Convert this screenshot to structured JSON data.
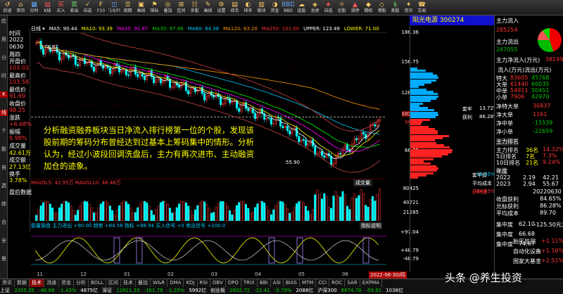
{
  "toolbar": [
    {
      "glyph": "↺",
      "label": "后退",
      "cls": "w"
    },
    {
      "glyph": "⌂",
      "label": "首页",
      "cls": ""
    },
    {
      "glyph": "▦",
      "label": "分时",
      "cls": "b"
    },
    {
      "glyph": "▤",
      "label": "K线",
      "cls": "r"
    },
    {
      "glyph": "买",
      "label": "买入",
      "cls": "r"
    },
    {
      "glyph": "卖",
      "label": "卖出",
      "cls": "gr"
    },
    {
      "glyph": "✓",
      "label": "自选",
      "cls": ""
    },
    {
      "glyph": "F",
      "label": "F10",
      "cls": ""
    },
    {
      "glyph": "◫",
      "label": "F10/F9",
      "cls": "b"
    },
    {
      "glyph": "☰",
      "label": "周期",
      "cls": ""
    },
    {
      "glyph": "▣",
      "label": "画线",
      "cls": ""
    },
    {
      "glyph": "⚑",
      "label": "指标",
      "cls": ""
    },
    {
      "glyph": "◎",
      "label": "叠加",
      "cls": ""
    },
    {
      "glyph": "⊞",
      "label": "区间",
      "cls": ""
    },
    {
      "glyph": "☷",
      "label": "多股",
      "cls": ""
    },
    {
      "glyph": "✎",
      "label": "画线",
      "cls": ""
    },
    {
      "glyph": "⚙",
      "label": "设置",
      "cls": ""
    },
    {
      "glyph": "▤",
      "label": "综合",
      "cls": ""
    },
    {
      "glyph": "◐",
      "label": "排名",
      "cls": ""
    },
    {
      "glyph": "▥",
      "label": "板块",
      "cls": ""
    },
    {
      "glyph": "◑",
      "label": "资金",
      "cls": ""
    },
    {
      "glyph": "BBD",
      "label": "BBD",
      "cls": "b"
    },
    {
      "glyph": "☁",
      "label": "选股",
      "cls": ""
    },
    {
      "glyph": "◈",
      "label": "龙虎",
      "cls": ""
    },
    {
      "glyph": "★",
      "label": "自选",
      "cls": "r"
    },
    {
      "glyph": "☼",
      "label": "论股",
      "cls": ""
    },
    {
      "glyph": "▲",
      "label": "涨停",
      "cls": "r"
    },
    {
      "glyph": "◆",
      "label": "期权",
      "cls": ""
    },
    {
      "glyph": "◇",
      "label": "港股",
      "cls": ""
    },
    {
      "glyph": "$",
      "label": "美股",
      "cls": "gr"
    },
    {
      "glyph": "✦",
      "label": "资讯",
      "cls": ""
    },
    {
      "glyph": "☎",
      "label": "交易",
      "cls": ""
    }
  ],
  "leftbar": [
    "应",
    "用",
    "分",
    "时",
    "K",
    "线",
    "个",
    "股",
    "自",
    "选",
    "综",
    "合",
    "全",
    "景"
  ],
  "info": {
    "time_label": "时间",
    "year": "2022",
    "date": "0630",
    "week_label": "周四",
    "open_label": "开盘价",
    "open": "103.03",
    "high_label": "最高价",
    "high": "103.58",
    "low_label": "最低价",
    "low": "91.69",
    "close_label": "收盘价",
    "close": "98.25",
    "change_label": "涨跌",
    "change": "+6.68%",
    "amp_label": "振幅",
    "amp": "9.98%",
    "vol_label": "成交量",
    "vol": "42.61万",
    "amt_label": "成交额",
    "amt": "27.13亿",
    "turn_label": "换手",
    "turn": "3.78%",
    "list_label": "盘后数据"
  },
  "ma_bar": [
    {
      "t": "日线 ▾",
      "c": "w"
    },
    {
      "t": "MA5: 90.44",
      "c": "w"
    },
    {
      "t": "MA10: 93.39",
      "c": "y"
    },
    {
      "t": "MA20: 91.87",
      "c": "m"
    },
    {
      "t": "MA30: 87.88",
      "c": "g"
    },
    {
      "t": "MA60: 84.38",
      "c": "c"
    },
    {
      "t": "MA120: 83.20",
      "c": "o"
    },
    {
      "t": "MA250: 101.00",
      "c": "r"
    },
    {
      "t": "UPPER: 123.49",
      "c": "w"
    },
    {
      "t": "LOWER: 71.00",
      "c": "y"
    }
  ],
  "price_axis": [
    "186.36",
    "156.75",
    "126.72",
    "103.03",
    "96.69",
    "66.65"
  ],
  "vol_axis": [
    "80425",
    "40721",
    "21285"
  ],
  "macd_axis": [
    "+97.04",
    "+48.79",
    "-48.79"
  ],
  "chart_labels": {
    "peak": "178.87",
    "low": "55.90",
    "vol_header": "MAVOL5: 42.95万  MAVOL10: 46.46万",
    "vol_tag": "成交量",
    "macd_header": "能量操盘  主力进出 +90.00  趋势 +84.58  指标 +88.94  买入信号 +0  卖出信号 +100.0",
    "macd_tag": "指标说明"
  },
  "x_axis": [
    "11",
    "12",
    "01",
    "02",
    "03",
    "04",
    "05",
    "06"
  ],
  "date_tag": "2022-06-30/四",
  "chart_data": {
    "type": "line",
    "title": "",
    "ylim": [
      55.9,
      186.36
    ],
    "x": [
      "2021-11",
      "2021-12",
      "2022-01",
      "2022-02",
      "2022-03",
      "2022-04",
      "2022-05",
      "2022-06"
    ],
    "series": [
      {
        "name": "",
        "values": [
          178.87,
          160,
          150,
          135,
          118,
          95,
          55.9,
          98.25
        ]
      }
    ]
  },
  "annotation": "分析融资融券板块当日净流入排行榜第一位的个股，发现该股前期的筹码分布曾经达到过基本上筹码集中的情形。分析认为，经过小波段回调洗盘后，主力有再次进市、主动融资加仓的迹象。",
  "stock_header": "阳光电源 300274",
  "side_panel": {
    "chip_label": "套牢",
    "chip_val": "13.72%",
    "profit_label": "获利",
    "profit_val": "86.28%",
    "cost_label": "平均成本",
    "cost_val": "89.70",
    "price_label": "收盘获利",
    "price_val": "84.65%",
    "label1": "套牢盘",
    "val1": "15.35%",
    "label2": "平均成本",
    "label3": "获利盘",
    "val3": "84.65%"
  },
  "right_panel": {
    "title": "主力流入",
    "flow_label": "主力流入",
    "flow_in": "285254",
    "flow_out_label": "主力流出",
    "flow_out": "247055",
    "net_label": "主力净流入(万元)",
    "net": "38199",
    "sub_title": "流入(万元)流出(万元)",
    "rows": [
      {
        "n": "特大",
        "a": "83605",
        "b": "45768"
      },
      {
        "n": "大单",
        "a": "61440",
        "b": "60035"
      },
      {
        "n": "中单",
        "a": "54911",
        "b": "50451"
      },
      {
        "n": "小单",
        "a": "7906",
        "b": "42970"
      }
    ],
    "net_rows": [
      {
        "n": "净特大单",
        "v": "36837",
        "c": "r"
      },
      {
        "n": "净大单",
        "v": "1161",
        "c": "r"
      },
      {
        "n": "净中单",
        "v": "-15539",
        "c": "g"
      },
      {
        "n": "净小单",
        "v": "-22659",
        "c": "g"
      }
    ],
    "rank_hdr": "主力排名",
    "rank_rows": [
      {
        "n": "主力排名",
        "v": "36名",
        "p": "14.32%"
      },
      {
        "n": "5日排名",
        "v": "7名",
        "p": "7.3%"
      },
      {
        "n": "10日排名",
        "v": "21名",
        "p": "9.24%"
      }
    ],
    "hist_hdr": "年度",
    "hist": [
      {
        "y": "2022",
        "a": "2.19",
        "b": "42.21"
      },
      {
        "y": "2023",
        "a": "2.94",
        "b": "55.67"
      }
    ],
    "stats": [
      {
        "n": "收盘获利",
        "v": "84.65%"
      },
      {
        "n": "光标获利",
        "v": "86.28%"
      },
      {
        "n": "平均成本",
        "v": "89.70"
      }
    ],
    "date": "20220630",
    "conc_label": "集中度",
    "conc": "62.10",
    "conc_range": "-125.50元之间",
    "conc2": "集中度",
    "conc2v": "66.68",
    "conc3": "集中度",
    "conc3v": "74.67",
    "hot_hdr": "所有板块排名",
    "hot": [
      {
        "n": "所有板块",
        "v": "涨幅"
      },
      {
        "n": "胎压监测",
        "v": "+1.11%"
      },
      {
        "n": "自动化设备",
        "v": "+1.16%"
      },
      {
        "n": "国家大基金",
        "v": "+2.51%"
      }
    ]
  },
  "bottom": {
    "tabs": [
      "资讯",
      "数据",
      "技术",
      "流通",
      "资金",
      "分析",
      "BOLL",
      "区间",
      "技术",
      "叠加",
      "W&R",
      "DMA",
      "KDJ",
      "RSI",
      "OBV",
      "DPO",
      "TRIX",
      "BBI",
      "ASI",
      "BIAS",
      "MTM",
      "CCI",
      "ROC",
      "SAR",
      "EXPMA"
    ],
    "active": 2,
    "indexes": [
      {
        "t": "上证",
        "c": "w"
      },
      {
        "t": "3355.35",
        "c": "g"
      },
      {
        "t": "-48.68",
        "c": "g"
      },
      {
        "t": "-1.43%",
        "c": "g"
      },
      {
        "t": "4875亿",
        "c": "w"
      },
      {
        "t": "深证",
        "c": "w"
      },
      {
        "t": "12811.33",
        "c": "g"
      },
      {
        "t": "-161.78",
        "c": "g"
      },
      {
        "t": "-1.25%",
        "c": "g"
      },
      {
        "t": "5992亿",
        "c": "w"
      },
      {
        "t": "创业板",
        "c": "w"
      },
      {
        "t": "2802.72",
        "c": "g"
      },
      {
        "t": "-22.41",
        "c": "g"
      },
      {
        "t": "-0.79%",
        "c": "g"
      },
      {
        "t": "2088亿",
        "c": "w"
      },
      {
        "t": "沪深300",
        "c": "w"
      },
      {
        "t": "8874.78",
        "c": "g"
      },
      {
        "t": "-59.91",
        "c": "g"
      },
      {
        "t": "1038亿",
        "c": "w"
      }
    ]
  },
  "watermark": "头条 @养生投资"
}
